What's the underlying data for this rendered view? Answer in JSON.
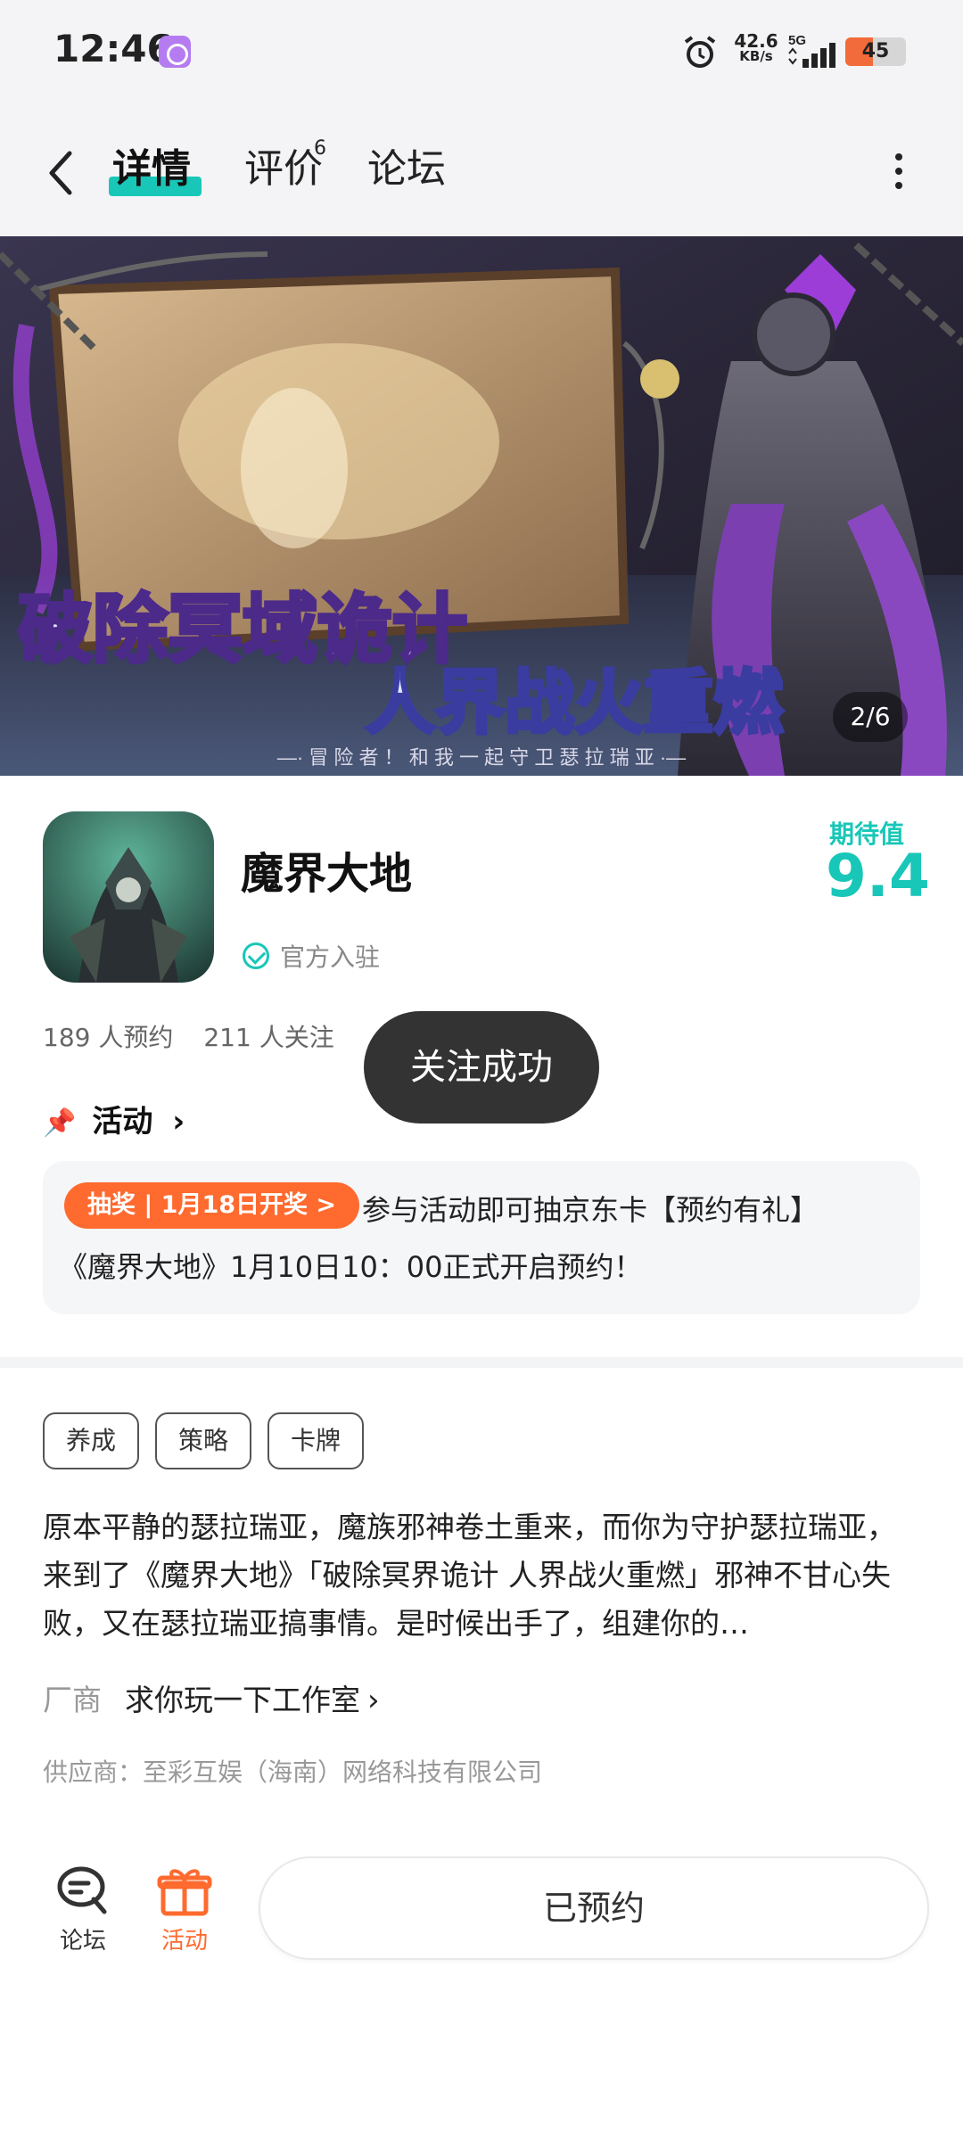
{
  "status_bar": {
    "time": "12:46",
    "net_speed_value": "42.6",
    "net_speed_unit": "KB/s",
    "network": "5G",
    "battery": 45,
    "battery_fraction": 0.45
  },
  "nav": {
    "tabs": [
      {
        "label": "详情",
        "active": true
      },
      {
        "label": "评价",
        "badge": "6"
      },
      {
        "label": "论坛"
      }
    ]
  },
  "banner": {
    "title_line1": "破除冥域诡计",
    "title_line2": "人界战火重燃",
    "caption": "—· 冒 险 者 ！ 和 我 一 起 守 卫 瑟 拉 瑞 亚 ·—",
    "pager": "2/6"
  },
  "app": {
    "name": "魔界大地",
    "official_label": "官方入驻",
    "rating_label": "期待值",
    "rating_value": "9.4",
    "reservations": "189 人预约",
    "followers": "211 人关注"
  },
  "toast": "关注成功",
  "activity": {
    "heading": "活动",
    "lottery_pill": "抽奖 | 1月18日开奖 >",
    "lottery_text": "参与活动即可抽京东卡【预约有礼】",
    "line2": "《魔界大地》1月10日10：00正式开启预约！"
  },
  "tags": [
    "养成",
    "策略",
    "卡牌"
  ],
  "description": "原本平静的瑟拉瑞亚，魔族邪神卷土重来，而你为守护瑟拉瑞亚，来到了《魔界大地》「破除冥界诡计 人界战火重燃」邪神不甘心失败，又在瑟拉瑞亚搞事情。是时候出手了，组建你的…",
  "vendor": {
    "label": "厂商",
    "name": "求你玩一下工作室"
  },
  "supplier": "供应商：至彩互娱（海南）网络科技有限公司",
  "bottom": {
    "forum_label": "论坛",
    "activity_label": "活动",
    "reserve_button": "已预约"
  },
  "colors": {
    "accent": "#19c7b8",
    "orange": "#ff6a2f",
    "toast_bg": "#333333"
  }
}
